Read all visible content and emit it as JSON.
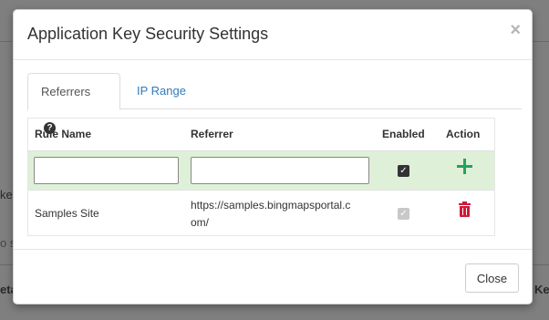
{
  "background": {
    "fragments": [
      "ke",
      "o s",
      "eta",
      "Ke"
    ]
  },
  "modal": {
    "title": "Application Key Security Settings",
    "close_symbol": "×",
    "tabs": [
      {
        "label": "Referrers",
        "active": true,
        "help_icon": "?"
      },
      {
        "label": "IP Range",
        "active": false
      }
    ],
    "table": {
      "headers": [
        "Rule Name",
        "Referrer",
        "Enabled",
        "Action"
      ],
      "new_row": {
        "rule_name": "",
        "referrer": "",
        "enabled": true,
        "action_icon": "plus-icon"
      },
      "rows": [
        {
          "rule_name": "Samples Site",
          "referrer_line1": "https://samples.bingmapsportal.c",
          "referrer_line2": "om/",
          "enabled": true,
          "action_icon": "trash-icon"
        }
      ]
    },
    "footer": {
      "close_label": "Close"
    }
  },
  "colors": {
    "tab_link": "#337ab7",
    "new_row_bg": "#dff0d8",
    "add_green": "#24a35a",
    "delete_red": "#d0183a"
  }
}
